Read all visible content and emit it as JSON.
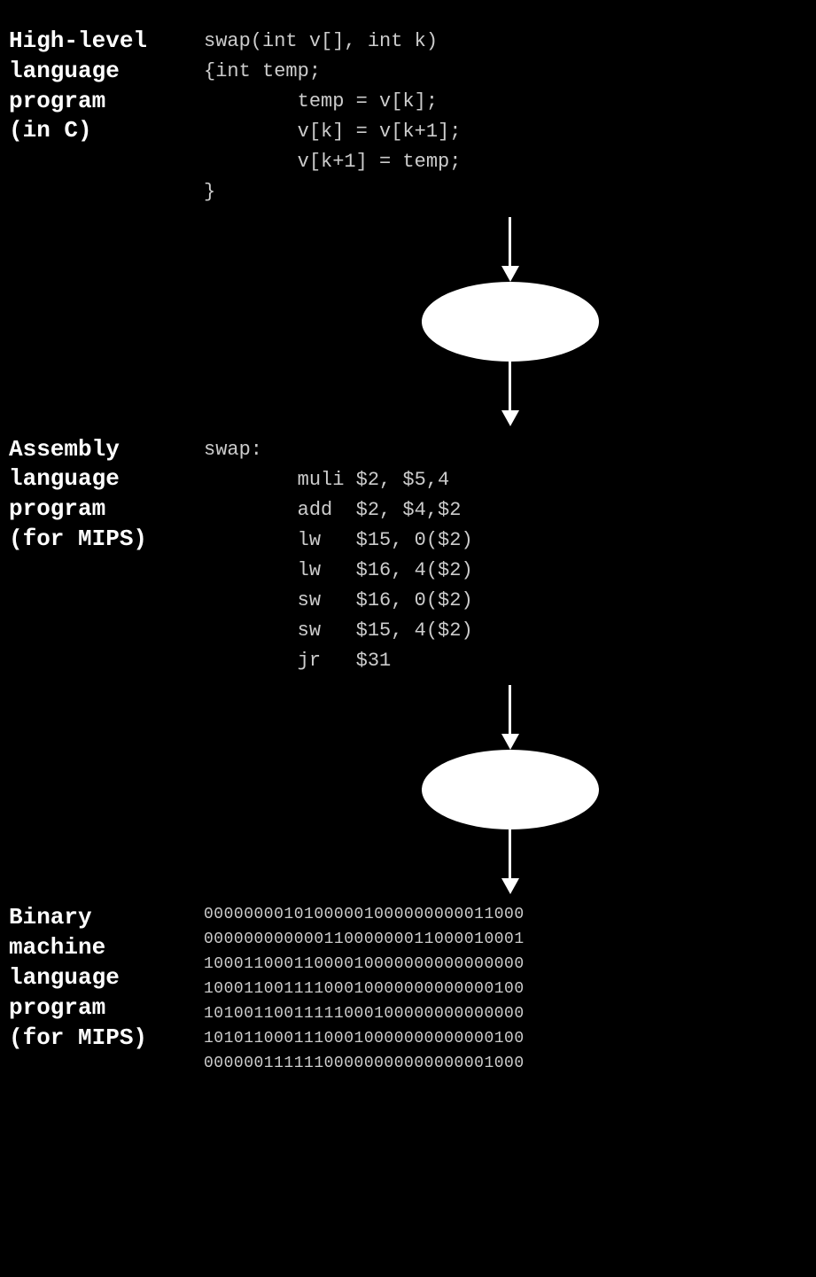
{
  "sections": {
    "highlevel": {
      "label_line1": "High-level",
      "label_line2": "language",
      "label_line3": "program",
      "label_line4": "(in C)",
      "code": "swap(int v[], int k)\n{int temp;\n        temp = v[k];\n        v[k] = v[k+1];\n        v[k+1] = temp;\n}"
    },
    "assembly": {
      "label_line1": "Assembly",
      "label_line2": "language",
      "label_line3": "program",
      "label_line4": "(for MIPS)",
      "code": "swap:\n        muli $2, $5,4\n        add  $2, $4,$2\n        lw   $15, 0($2)\n        lw   $16, 4($2)\n        sw   $16, 0($2)\n        sw   $15, 4($2)\n        jr   $31"
    },
    "binary": {
      "label_line1": "Binary machine",
      "label_line2": "language",
      "label_line3": "program",
      "label_line4": "(for MIPS)",
      "code": "00000000101000001000000000011000\n00000000000011000000011000010001\n10001100011000010000000000000000\n10001100111100010000000000000100\n10100110011111000100000000000000\n10101100011100010000000000000100\n00000011111100000000000000001000"
    }
  }
}
